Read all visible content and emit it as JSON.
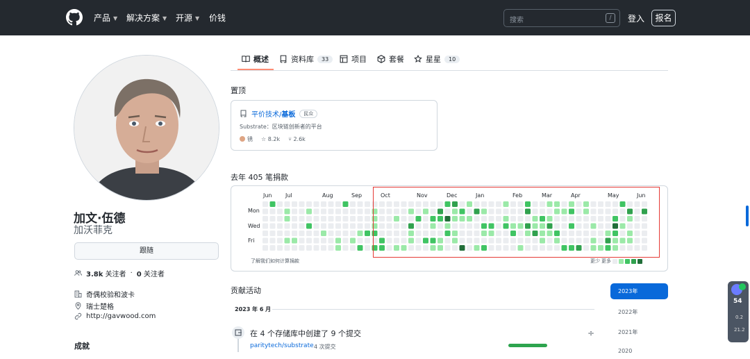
{
  "nav": {
    "items": [
      {
        "label": "产品",
        "has_menu": true
      },
      {
        "label": "解决方案",
        "has_menu": true
      },
      {
        "label": "开源",
        "has_menu": true
      },
      {
        "label": "价钱",
        "has_menu": false
      }
    ],
    "search_placeholder": "搜索",
    "search_shortcut": "/",
    "login": "登入",
    "signup": "报名"
  },
  "tabs": [
    {
      "label": "概述",
      "count": "",
      "icon": "book-icon",
      "active": true
    },
    {
      "label": "资料库",
      "count": "33",
      "icon": "repo-icon",
      "active": false
    },
    {
      "label": "项目",
      "count": "",
      "icon": "table-icon",
      "active": false
    },
    {
      "label": "套餐",
      "count": "",
      "icon": "package-icon",
      "active": false
    },
    {
      "label": "星星",
      "count": "10",
      "icon": "star-icon",
      "active": false
    }
  ],
  "profile": {
    "name": "加文·伍德",
    "login": "加沃菲克",
    "follow_label": "跟随",
    "followers_count": "3.8k",
    "followers_label": "关注者",
    "following_count": "0",
    "following_label": "关注者",
    "company": "奇偶校验和波卡",
    "location": "瑞士楚格",
    "website": "http://gavwood.com",
    "achievements_label": "成就"
  },
  "pinned": {
    "section_label": "置顶",
    "repo_owner": "平价技术/",
    "repo_name": "基板",
    "visibility": "民众",
    "description": "Substrate：区块链创新者的平台",
    "language": "锈",
    "language_color": "#dea584",
    "stars": "8.2k",
    "forks": "2.6k"
  },
  "contributions": {
    "title": "去年 405 笔捐款",
    "months": [
      "Jun",
      "Jul",
      "Aug",
      "Sep",
      "Oct",
      "Nov",
      "Dec",
      "Jan",
      "Feb",
      "Mar",
      "Apr",
      "May",
      "Jun"
    ],
    "day_labels": [
      "Mon",
      "Wed",
      "Fri"
    ],
    "learn_more": "了解我们如何计算捐款",
    "legend_less": "更少",
    "legend_more": "更多",
    "colors": [
      "#ebedf0",
      "#9be9a8",
      "#40c463",
      "#30a14e",
      "#216e39"
    ],
    "weeks": 53,
    "pattern_seed": 7,
    "active_from_week": 15
  },
  "activity": {
    "title": "贡献活动",
    "month_header": "2023 年 6 月",
    "summary": "在 4 个存储库中创建了 9 个提交",
    "repo": "paritytech/substrate",
    "repo_commits": "4 次提交",
    "years": [
      "2023年",
      "2022年",
      "2021年",
      "2020"
    ]
  },
  "widget": {
    "value": "54",
    "stat1": "0.2",
    "stat2": "21.2"
  }
}
